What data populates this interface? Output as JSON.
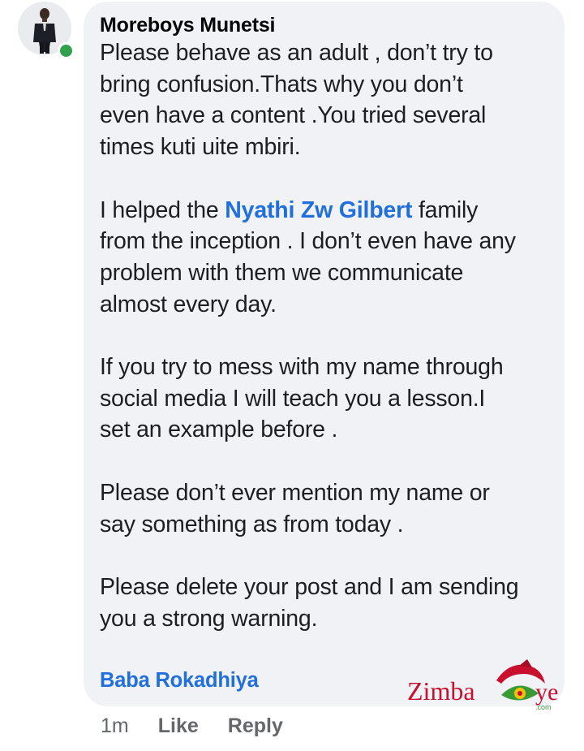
{
  "comment": {
    "author": "Moreboys Munetsi",
    "paragraphs": [
      {
        "lines": [
          "Please behave as an adult , don’t try to",
          "bring confusion.Thats why you don’t",
          "even have a content .You tried several",
          "times kuti uite mbiri."
        ]
      },
      {
        "before_mention": "I helped the ",
        "mention": "Nyathi Zw Gilbert",
        "after_mention": " family",
        "lines": [
          "from the inception . I don’t even have any",
          "problem with them we communicate",
          "almost every day."
        ]
      },
      {
        "lines": [
          "If you try to mess with my name through",
          "social media I will teach you a lesson.I",
          "set an example before ."
        ]
      },
      {
        "lines": [
          "Please don’t ever mention my name or",
          "say something as from today ."
        ]
      },
      {
        "lines": [
          "Please delete your post and I am sending",
          "you a strong warning."
        ]
      }
    ],
    "tagged_user": "Baba Rokadhiya",
    "timestamp": "1m",
    "like_label": "Like",
    "reply_label": "Reply"
  },
  "watermark": {
    "brand_prefix": "Zimba",
    "brand_suffix": "ye",
    "domain": ".com"
  },
  "colors": {
    "bubble_bg": "#f0f2f5",
    "mention": "#216fdb",
    "online": "#31a24c",
    "meta_text": "#65676b",
    "watermark_red": "#c8102e",
    "watermark_green": "#3a9a35"
  },
  "icons": {
    "avatar": "profile-photo-man-in-suit",
    "online": "online-status-dot"
  }
}
